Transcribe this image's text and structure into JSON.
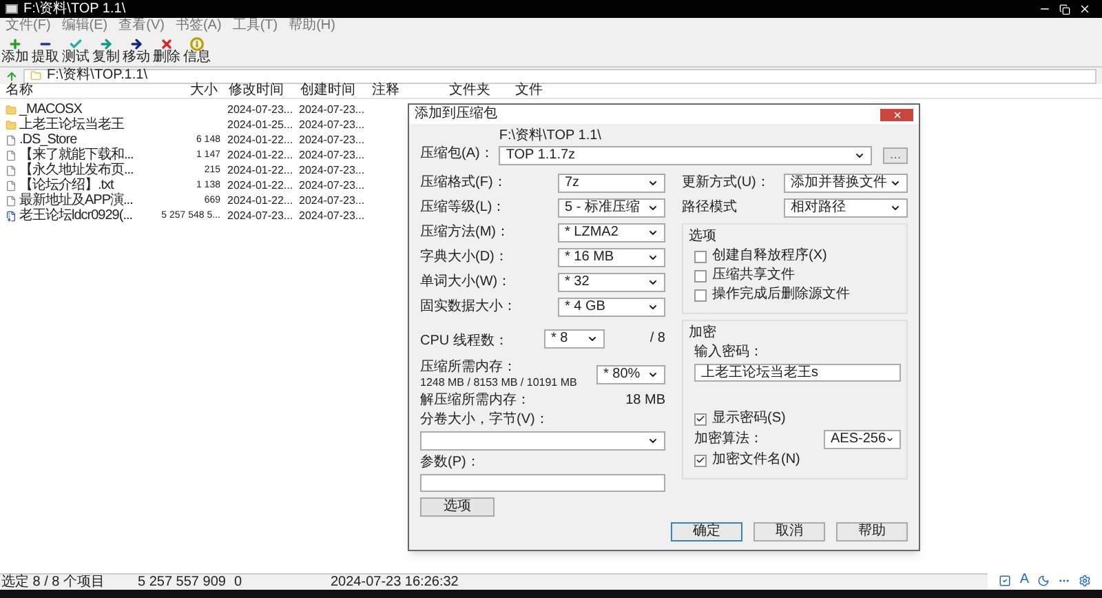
{
  "window": {
    "title": "F:\\资料\\TOP 1.1\\"
  },
  "menu": [
    "文件(F)",
    "编辑(E)",
    "查看(V)",
    "书签(A)",
    "工具(T)",
    "帮助(H)"
  ],
  "toolbar": [
    {
      "kind": "add",
      "label": "添加"
    },
    {
      "kind": "extract",
      "label": "提取"
    },
    {
      "kind": "test",
      "label": "测试"
    },
    {
      "kind": "copy",
      "label": "复制"
    },
    {
      "kind": "move",
      "label": "移动"
    },
    {
      "kind": "delete",
      "label": "删除"
    },
    {
      "kind": "info",
      "label": "信息"
    }
  ],
  "address": "F:\\资料\\TOP.1.1\\",
  "columns": [
    "名称",
    "大小",
    "修改时间",
    "创建时间",
    "注释",
    "文件夹",
    "文件"
  ],
  "rows": [
    {
      "kind": "folder",
      "name": "_MACOSX",
      "size": "",
      "modified": "2024-07-23...",
      "created": "2024-07-23..."
    },
    {
      "kind": "folder",
      "name": "上老王论坛当老王",
      "size": "",
      "modified": "2024-01-25...",
      "created": "2024-07-23..."
    },
    {
      "kind": "file",
      "name": ".DS_Store",
      "size": "6 148",
      "modified": "2024-01-22...",
      "created": "2024-07-23..."
    },
    {
      "kind": "file",
      "name": "【来了就能下载和...",
      "size": "1 147",
      "modified": "2024-01-22...",
      "created": "2024-07-23..."
    },
    {
      "kind": "file",
      "name": "【永久地址发布页...",
      "size": "215",
      "modified": "2024-01-22...",
      "created": "2024-07-23..."
    },
    {
      "kind": "file",
      "name": "【论坛介绍】.txt",
      "size": "1 138",
      "modified": "2024-01-22...",
      "created": "2024-07-23..."
    },
    {
      "kind": "file",
      "name": "最新地址及APP演...",
      "size": "669",
      "modified": "2024-01-22...",
      "created": "2024-07-23..."
    },
    {
      "kind": "archive",
      "name": "老王论坛ldcr0929(...",
      "size": "5 257 548 5...",
      "modified": "2024-07-23...",
      "created": "2024-07-23..."
    }
  ],
  "dialog": {
    "title": "添加到压缩包",
    "archive": {
      "label": "压缩包(A)：",
      "path": "F:\\资料\\TOP 1.1\\",
      "value": "TOP 1.1.7z",
      "browse": "..."
    },
    "left_fields": [
      {
        "label": "压缩格式(F)：",
        "value": "7z"
      },
      {
        "label": "压缩等级(L)：",
        "value": "5 - 标准压缩"
      },
      {
        "label": "压缩方法(M)：",
        "value": "* LZMA2"
      },
      {
        "label": "字典大小(D)：",
        "value": "* 16 MB"
      },
      {
        "label": "单词大小(W)：",
        "value": "* 32"
      },
      {
        "label": "固实数据大小：",
        "value": "* 4 GB"
      }
    ],
    "cpu": {
      "label": "CPU 线程数：",
      "value": "* 8",
      "total": "/ 8"
    },
    "memory": {
      "label": "压缩所需内存：",
      "detail": "1248 MB / 8153 MB / 10191 MB",
      "value": "* 80%"
    },
    "decompress_memory": {
      "label": "解压缩所需内存：",
      "value": "18 MB"
    },
    "split": {
      "label": "分卷大小，字节(V)："
    },
    "params": {
      "label": "参数(P)："
    },
    "options_button": "选项",
    "update_mode": {
      "label": "更新方式(U)：",
      "value": "添加并替换文件"
    },
    "path_mode": {
      "label": "路径模式",
      "value": "相对路径"
    },
    "options": {
      "title": "选项",
      "items": [
        {
          "label": "创建自释放程序(X)",
          "checked": false
        },
        {
          "label": "压缩共享文件",
          "checked": false
        },
        {
          "label": "操作完成后删除源文件",
          "checked": false
        }
      ]
    },
    "encryption": {
      "title": "加密",
      "password_label": "输入密码：",
      "password": "上老王论坛当老王s",
      "show_password": {
        "label": "显示密码(S)",
        "checked": true
      },
      "method_label": "加密算法：",
      "method": "AES-256",
      "encrypt_names": {
        "label": "加密文件名(N)",
        "checked": true
      }
    },
    "buttons": [
      "确定",
      "取消",
      "帮助"
    ]
  },
  "status_bar": [
    "选定 8 / 8 个项目",
    "5 257 557 909",
    "0",
    "2024-07-23 16:26:32"
  ],
  "ime_toolbar": {
    "letter": "A"
  }
}
